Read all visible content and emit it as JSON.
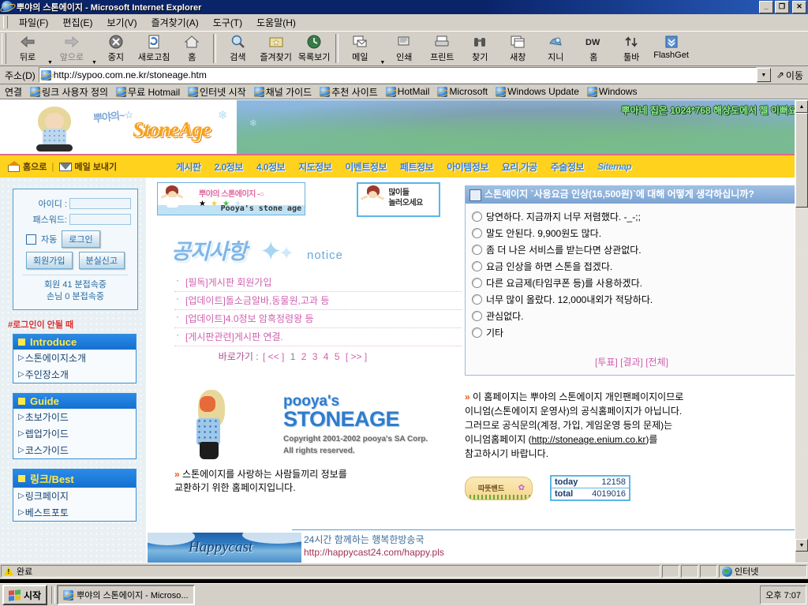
{
  "window": {
    "title": "뿌야의 스톤에이지 - Microsoft Internet Explorer",
    "minimize": "_",
    "maximize": "❐",
    "close": "✕"
  },
  "menubar": [
    {
      "label": "파일(F)"
    },
    {
      "label": "편집(E)"
    },
    {
      "label": "보기(V)"
    },
    {
      "label": "즐겨찾기(A)"
    },
    {
      "label": "도구(T)"
    },
    {
      "label": "도움말(H)"
    }
  ],
  "toolbar": {
    "buttons": [
      {
        "label": "뒤로",
        "icon": "back-arrow-icon",
        "disabled": false,
        "dropdown": true
      },
      {
        "label": "앞으로",
        "icon": "forward-arrow-icon",
        "disabled": true,
        "dropdown": true
      },
      {
        "label": "중지",
        "icon": "stop-icon",
        "disabled": false
      },
      {
        "label": "새로고침",
        "icon": "refresh-icon",
        "disabled": false
      },
      {
        "label": "홈",
        "icon": "home-icon",
        "disabled": false
      },
      {
        "label": "검색",
        "icon": "search-icon",
        "disabled": false
      },
      {
        "label": "즐겨찾기",
        "icon": "favorites-icon",
        "disabled": false
      },
      {
        "label": "목록보기",
        "icon": "history-icon",
        "disabled": false
      },
      {
        "label": "메일",
        "icon": "mail-icon",
        "disabled": false,
        "dropdown": true
      },
      {
        "label": "인쇄",
        "icon": "print-icon",
        "disabled": false
      },
      {
        "label": "프린트",
        "icon": "printer-icon",
        "disabled": false
      },
      {
        "label": "찾기",
        "icon": "binoculars-icon",
        "disabled": false
      },
      {
        "label": "새창",
        "icon": "new-window-icon",
        "disabled": false
      },
      {
        "label": "지니",
        "icon": "genie-icon",
        "disabled": false
      },
      {
        "label": "홈",
        "icon": "dreamweaver-icon",
        "disabled": false
      },
      {
        "label": "툴바",
        "icon": "updown-arrows-icon",
        "disabled": false
      },
      {
        "label": "FlashGet",
        "icon": "flashget-icon",
        "disabled": false
      }
    ]
  },
  "address": {
    "label": "주소(D)",
    "value": "http://sypoo.com.ne.kr/stoneage.htm",
    "go_label": "이동"
  },
  "links": {
    "label": "연결",
    "items": [
      {
        "label": "링크 사용자 정의"
      },
      {
        "label": "무료 Hotmail"
      },
      {
        "label": "인터넷 시작"
      },
      {
        "label": "채널 가이드"
      },
      {
        "label": "추천 사이트"
      },
      {
        "label": "HotMail"
      },
      {
        "label": "Microsoft"
      },
      {
        "label": "Windows Update"
      },
      {
        "label": "Windows"
      }
    ]
  },
  "site": {
    "banner": {
      "logo_ko": "뿌야의~☆",
      "logo_main": "StoneAge",
      "resolution_msg": "뿌아네 집은 1024*768 해상도에서 젤 이뻐요!!"
    },
    "nav": {
      "home_label": "홈으로",
      "mail_label": "메일 보내기",
      "divider": "|",
      "links": [
        {
          "label": "게시판"
        },
        {
          "label": "2.0정보"
        },
        {
          "label": "4.0정보"
        },
        {
          "label": "지도정보"
        },
        {
          "label": "이벤트정보"
        },
        {
          "label": "페트정보"
        },
        {
          "label": "아이템정보"
        },
        {
          "label": "요리,가공"
        },
        {
          "label": "주술정보"
        },
        {
          "label": "Sitemap"
        }
      ]
    },
    "login": {
      "id_label": "아이디 :",
      "pw_label": "패스워드:",
      "id_value": "",
      "pw_value": "",
      "auto_label": "자동",
      "login_button": "로그인",
      "signup_button": "회원가입",
      "lost_button": "분실신고",
      "member_stat": "회원  41 분접속중",
      "guest_stat": "손님  0 분접속중"
    },
    "sidebar": {
      "hint": "#로그인이 안될 때",
      "groups": [
        {
          "title": "Introduce",
          "items": [
            {
              "label": "스톤에이지소개"
            },
            {
              "label": "주인장소개"
            }
          ]
        },
        {
          "title": "Guide",
          "items": [
            {
              "label": "초보가이드"
            },
            {
              "label": "렙업가이드"
            },
            {
              "label": "코스가이드"
            }
          ]
        },
        {
          "title": "링크/Best",
          "items": [
            {
              "label": "링크페이지"
            },
            {
              "label": "베스트포토"
            }
          ]
        }
      ]
    },
    "ads": {
      "banner1_ko": "뿌야의 스톤에이지 -○",
      "banner1_en": "Pooya's stone age",
      "banner2_line1": "많이들",
      "banner2_line2": "놀러오세요"
    },
    "notice": {
      "title_ko": "공지사항",
      "title_en": "notice",
      "items": [
        {
          "label": "[필독]게시판 회원가입"
        },
        {
          "label": "[업데이트]돌소금알바,동물원,고과 등"
        },
        {
          "label": "[업데이트]4.0정보 암흑정령왕 등"
        },
        {
          "label": "[게시판관련]게시판 연결."
        }
      ],
      "pager_label": "바로가기 :",
      "pager_prev": "[ << ]",
      "pager_pages": [
        "1",
        "2",
        "3",
        "4",
        "5"
      ],
      "pager_next": "[ >> ]"
    },
    "poll": {
      "question": "스톤에이지 `사용요금 인상(16,500원)`에 대해 어떻게 생각하십니까?",
      "options": [
        {
          "label": "당연하다. 지금까지 너무 저렴했다. -_-;;"
        },
        {
          "label": "말도 안된다. 9,900원도 많다."
        },
        {
          "label": "좀 더 나은 서비스를 받는다면 상관없다."
        },
        {
          "label": "요금 인상을 하면 스톤을 접겠다."
        },
        {
          "label": "다른 요금제(타임쿠폰 등)를 사용하겠다."
        },
        {
          "label": "너무 많이 올랐다. 12,000내외가 적당하다."
        },
        {
          "label": "관심없다."
        },
        {
          "label": "기타"
        }
      ],
      "vote_label": "[투표]",
      "result_label": "[결과]",
      "all_label": "[전체]"
    },
    "footer": {
      "logo_line1": "pooya's",
      "logo_line2": "STONEAGE",
      "copyright_line1": "Copyright   2001-2002 pooya's SA Corp.",
      "copyright_line2": "All rights reserved.",
      "note_line1": "스톤에이지를 사랑하는 사람들끼리 정보를",
      "note_line2": "교환하기 위한 홈페이지입니다.",
      "disclaimer_line1": "이 홈페이지는 뿌야의 스톤에이지 개인팬페이지이므로",
      "disclaimer_line2": "이니엄(스톤에이지 운영사)의 공식홈페이지가 아닙니다.",
      "disclaimer_line3": "그러므로 공식문의(계정, 가입, 게임운영 등의 문제)는",
      "disclaimer_line4_pre": "이니엄홈페이지 (",
      "disclaimer_link": "http://stoneage.enium.co.kr",
      "disclaimer_line4_post": ")를",
      "disclaimer_line5": "참고하시기 바랍니다.",
      "band_label": "따뜻밴드",
      "counter": {
        "today_label": "today",
        "today_value": "12158",
        "total_label": "total",
        "total_value": "4019016"
      }
    },
    "happycast": {
      "logo": "Happycast",
      "line1": "24시간 함께하는 행복한방송국",
      "line2": "http://happycast24.com/happy.pls"
    }
  },
  "statusbar": {
    "message": "완료",
    "zone": "인터넷"
  },
  "taskbar": {
    "start_label": "시작",
    "items": [
      {
        "label": "뿌야의 스톤에이지 - Microso..."
      }
    ],
    "clock": "오후 7:07"
  }
}
